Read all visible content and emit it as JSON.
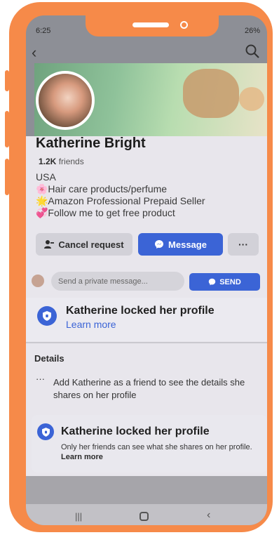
{
  "status_bar": {
    "time": "6:25",
    "battery": "26%"
  },
  "profile": {
    "name": "Katherine Bright",
    "friends_count": "1.2K",
    "friends_label": "friends",
    "bio": [
      "USA",
      "🌸Hair care products/perfume",
      "🌟Amazon Professional Prepaid Seller",
      "💞Follow me to get free product"
    ]
  },
  "actions": {
    "cancel_request_label": "Cancel request",
    "message_label": "Message",
    "more_label": "···"
  },
  "private_message": {
    "placeholder": "Send a private message...",
    "send_label": "SEND"
  },
  "locked_banner": {
    "title": "Katherine locked her profile",
    "link": "Learn more"
  },
  "details": {
    "heading": "Details",
    "text": "Add Katherine as a friend to see the details she shares on her profile"
  },
  "locked_card": {
    "title": "Katherine locked her profile",
    "text": "Only her friends can see what she shares on her profile.",
    "link": "Learn more"
  },
  "colors": {
    "frame": "#f68a49",
    "accent": "#3b64d6"
  }
}
